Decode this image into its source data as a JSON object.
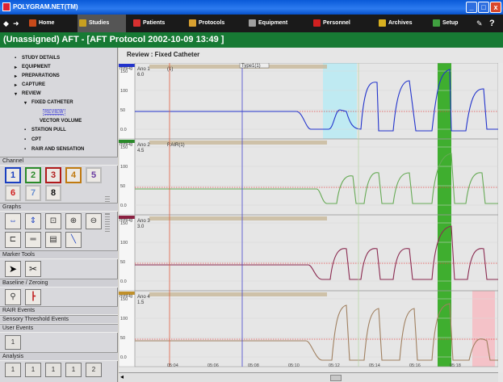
{
  "window": {
    "title": "POLYGRAM.NET(TM)",
    "buttons": [
      "_",
      "□",
      "x"
    ]
  },
  "menubar": {
    "items": [
      {
        "label": "Home",
        "color": "#c84a1a"
      },
      {
        "label": "Studies",
        "color": "#c8a020",
        "active": true
      },
      {
        "label": "Patients",
        "color": "#d83030"
      },
      {
        "label": "Protocols",
        "color": "#d8a030"
      },
      {
        "label": "Equipment",
        "color": "#a0a0a0"
      },
      {
        "label": "Personnel",
        "color": "#d02020"
      },
      {
        "label": "Archives",
        "color": "#d8b020"
      },
      {
        "label": "Setup",
        "color": "#40a040"
      }
    ],
    "help": "?"
  },
  "status": {
    "text": "(Unassigned)  AFT - [AFT Protocol  2002-10-09  13:49 ]"
  },
  "tree": [
    {
      "label": "STUDY DETAILS"
    },
    {
      "label": "EQUIPMENT"
    },
    {
      "label": "PREPARATIONS"
    },
    {
      "label": "CAPTURE"
    },
    {
      "label": "REVIEW"
    },
    {
      "label": "FIXED CATHETER"
    },
    {
      "label": "REVIEW"
    },
    {
      "label": "VECTOR VOLUME"
    },
    {
      "label": "STATION PULL"
    },
    {
      "label": "CPT"
    },
    {
      "label": "RAIR AND SENSATION"
    }
  ],
  "sections": {
    "channel": "Channel",
    "graphs": "Graphs",
    "marker_tools": "Marker Tools",
    "baseline": "Baseline / Zeroing",
    "rair": "RAIR Events",
    "sensory": "Sensory Threshold Events",
    "user_events": "User Events",
    "analysis": "Analysis"
  },
  "channels": [
    {
      "label": "1",
      "color": "#1a3fc0"
    },
    {
      "label": "2",
      "color": "#2a8a2a"
    },
    {
      "label": "3",
      "color": "#b01a1a"
    },
    {
      "label": "4",
      "color": "#c07a10"
    },
    {
      "label": "5",
      "color": "#6a3aa0"
    },
    {
      "label": "6",
      "color": "#d02020"
    },
    {
      "label": "7",
      "color": "#6a90d0"
    },
    {
      "label": "8",
      "color": "#111111"
    }
  ],
  "user_event_button": "1",
  "analysis_buttons": [
    "1",
    "1",
    "1",
    "1",
    "2"
  ],
  "review": {
    "header": "Review : Fixed Catheter"
  },
  "traces": [
    {
      "name": "Ano 1",
      "value": "6.0",
      "marker": "(1)",
      "color": "#2233cc",
      "band": "#2233cc"
    },
    {
      "name": "Ano 2",
      "value": "4.5",
      "marker": "RAIR(1)",
      "color": "#66aa55",
      "band": "#2a8a2a"
    },
    {
      "name": "Ano 3",
      "value": "3.0",
      "marker": "",
      "color": "#8a2a50",
      "band": "#8a2040"
    },
    {
      "name": "Ano 4",
      "value": "1.5",
      "marker": "",
      "color": "#a08060",
      "band": "#c0902a"
    }
  ],
  "top_marker": "Type1(1)",
  "y_ticks": [
    "150",
    "100",
    "50",
    "0.0"
  ],
  "units": "mmHg",
  "time_ticks": [
    "05:04",
    "05:06",
    "05:08",
    "05:10",
    "05:12",
    "05:14",
    "05:16",
    "05:18"
  ]
}
